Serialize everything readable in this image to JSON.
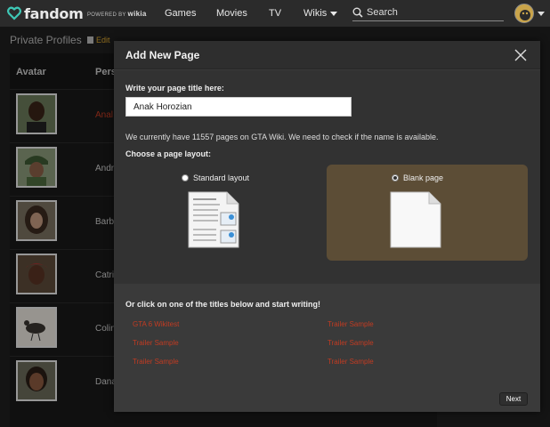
{
  "topnav": {
    "logo_text": "fandom",
    "powered_by": "POWERED BY",
    "powered_brand": "wikia",
    "links": [
      "Games",
      "Movies",
      "TV",
      "Wikis"
    ],
    "search_placeholder": "Search"
  },
  "page": {
    "title": "Private Profiles",
    "edit_label": "Edit",
    "columns": [
      "Avatar",
      "Pers"
    ],
    "rows": [
      {
        "name": "Anal"
      },
      {
        "name": "Andr"
      },
      {
        "name": "Barb"
      },
      {
        "name": "Catri"
      },
      {
        "name": "Colin"
      },
      {
        "name": "Dana"
      }
    ]
  },
  "modal": {
    "title": "Add New Page",
    "title_label": "Write your page title here:",
    "title_value": "Anak Horozian",
    "availability_text": "We currently have 11557 pages on GTA Wiki. We need to check if the name is available.",
    "layout_label": "Choose a page layout:",
    "layouts": [
      {
        "label": "Standard layout",
        "selected": false
      },
      {
        "label": "Blank page",
        "selected": true
      }
    ],
    "click_label": "Or click on one of the titles below and start writing!",
    "suggestions": [
      "GTA 6 Wikitest",
      "Trailer Sample",
      "Trailer Sample",
      "Trailer Sample",
      "Trailer Sample",
      "Trailer Sample"
    ],
    "next_label": "Next"
  },
  "colors": {
    "accent_link": "#c23b22",
    "edit_link": "#d9a530",
    "selected_layout_bg": "#5c4d36",
    "nav_bg": "#2b2b2b"
  }
}
